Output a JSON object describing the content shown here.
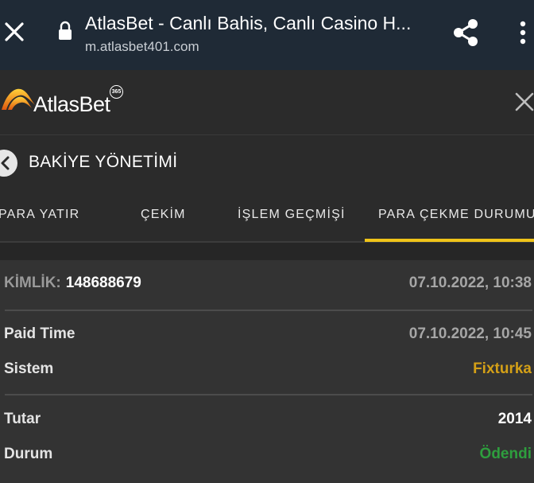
{
  "browser": {
    "title": "AtlasBet - Canlı Bahis, Canlı Casino H...",
    "url": "m.atlasbet401.com"
  },
  "app": {
    "logo_text": "AtlasBet",
    "logo_badge": "365"
  },
  "section": {
    "title": "BAKİYE YÖNETİMİ"
  },
  "tabs": [
    {
      "label": "PARA YATIR",
      "active": false
    },
    {
      "label": "ÇEKİM",
      "active": false
    },
    {
      "label": "İŞLEM GEÇMİŞİ",
      "active": false
    },
    {
      "label": "PARA ÇEKME DURUMU",
      "active": true
    }
  ],
  "details": {
    "id_label": "KİMLİK:",
    "id_value": "148688679",
    "id_datetime": "07.10.2022, 10:38",
    "paid_time_label": "Paid Time",
    "paid_time_value": "07.10.2022, 10:45",
    "system_label": "Sistem",
    "system_value": "Fixturka",
    "amount_label": "Tutar",
    "amount_value": "2014",
    "status_label": "Durum",
    "status_value": "Ödendi"
  },
  "colors": {
    "accent": "#f0c419",
    "system_value": "#d4a017",
    "status_paid": "#2e9e3e",
    "browser_bar": "#1f2a36",
    "background": "#2b2b2b"
  },
  "icons": {
    "browser_close": "close-icon",
    "lock": "lock-icon",
    "share": "share-icon",
    "more": "more-vertical-icon",
    "app_close": "close-icon",
    "back": "chevron-left-icon"
  }
}
